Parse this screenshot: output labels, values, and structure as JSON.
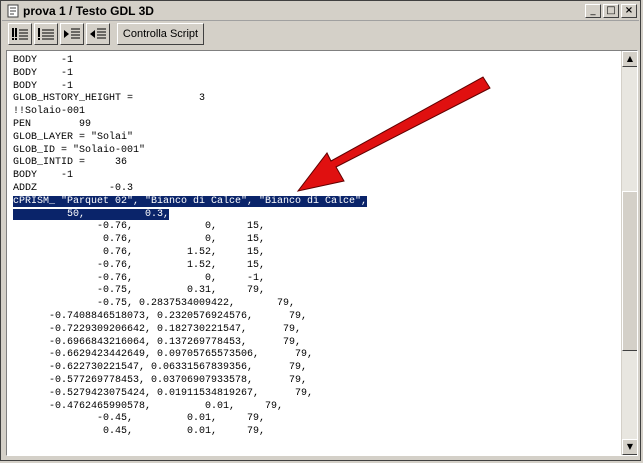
{
  "window": {
    "title": "prova 1 / Testo GDL 3D",
    "minimize_glyph": "_",
    "maximize_glyph": "□",
    "close_glyph": "×"
  },
  "toolbar": {
    "check_script_label": "Controlla Script"
  },
  "editor": {
    "lines": [
      "BODY    -1",
      "BODY    -1",
      "BODY    -1",
      "GLOB_HSTORY_HEIGHT =           3",
      "!!Solaio-001",
      "PEN        99",
      "GLOB_LAYER = \"Solai\"",
      "GLOB_ID = \"Solaio-001\"",
      "GLOB_INTID =     36",
      "BODY    -1",
      "ADDZ            -0.3",
      "cPRISM_ \"Parquet 02\", \"Bianco di Calce\", \"Bianco di Calce\",",
      "         50,          0.3,",
      "              -0.76,            0,     15,",
      "               0.76,            0,     15,",
      "               0.76,         1.52,     15,",
      "              -0.76,         1.52,     15,",
      "              -0.76,            0,     -1,",
      "              -0.75,         0.31,     79,",
      "              -0.75, 0.2837534009422,       79,",
      "      -0.7408846518073, 0.2320576924576,      79,",
      "      -0.7229309206642, 0.182730221547,      79,",
      "      -0.6966843216064, 0.137269778453,      79,",
      "      -0.6629423442649, 0.09705765573506,      79,",
      "      -0.622730221547, 0.06331567839356,      79,",
      "      -0.577269778453, 0.03706907933578,      79,",
      "      -0.5279423075424, 0.01911534819267,      79,",
      "      -0.4762465990578,         0.01,     79,",
      "              -0.45,         0.01,     79,",
      "               0.45,         0.01,     79,"
    ]
  },
  "scrollbar": {
    "up_glyph": "▲",
    "down_glyph": "▼"
  },
  "colors": {
    "selection": "#0a246a",
    "annotation_arrow": "#e01010"
  }
}
